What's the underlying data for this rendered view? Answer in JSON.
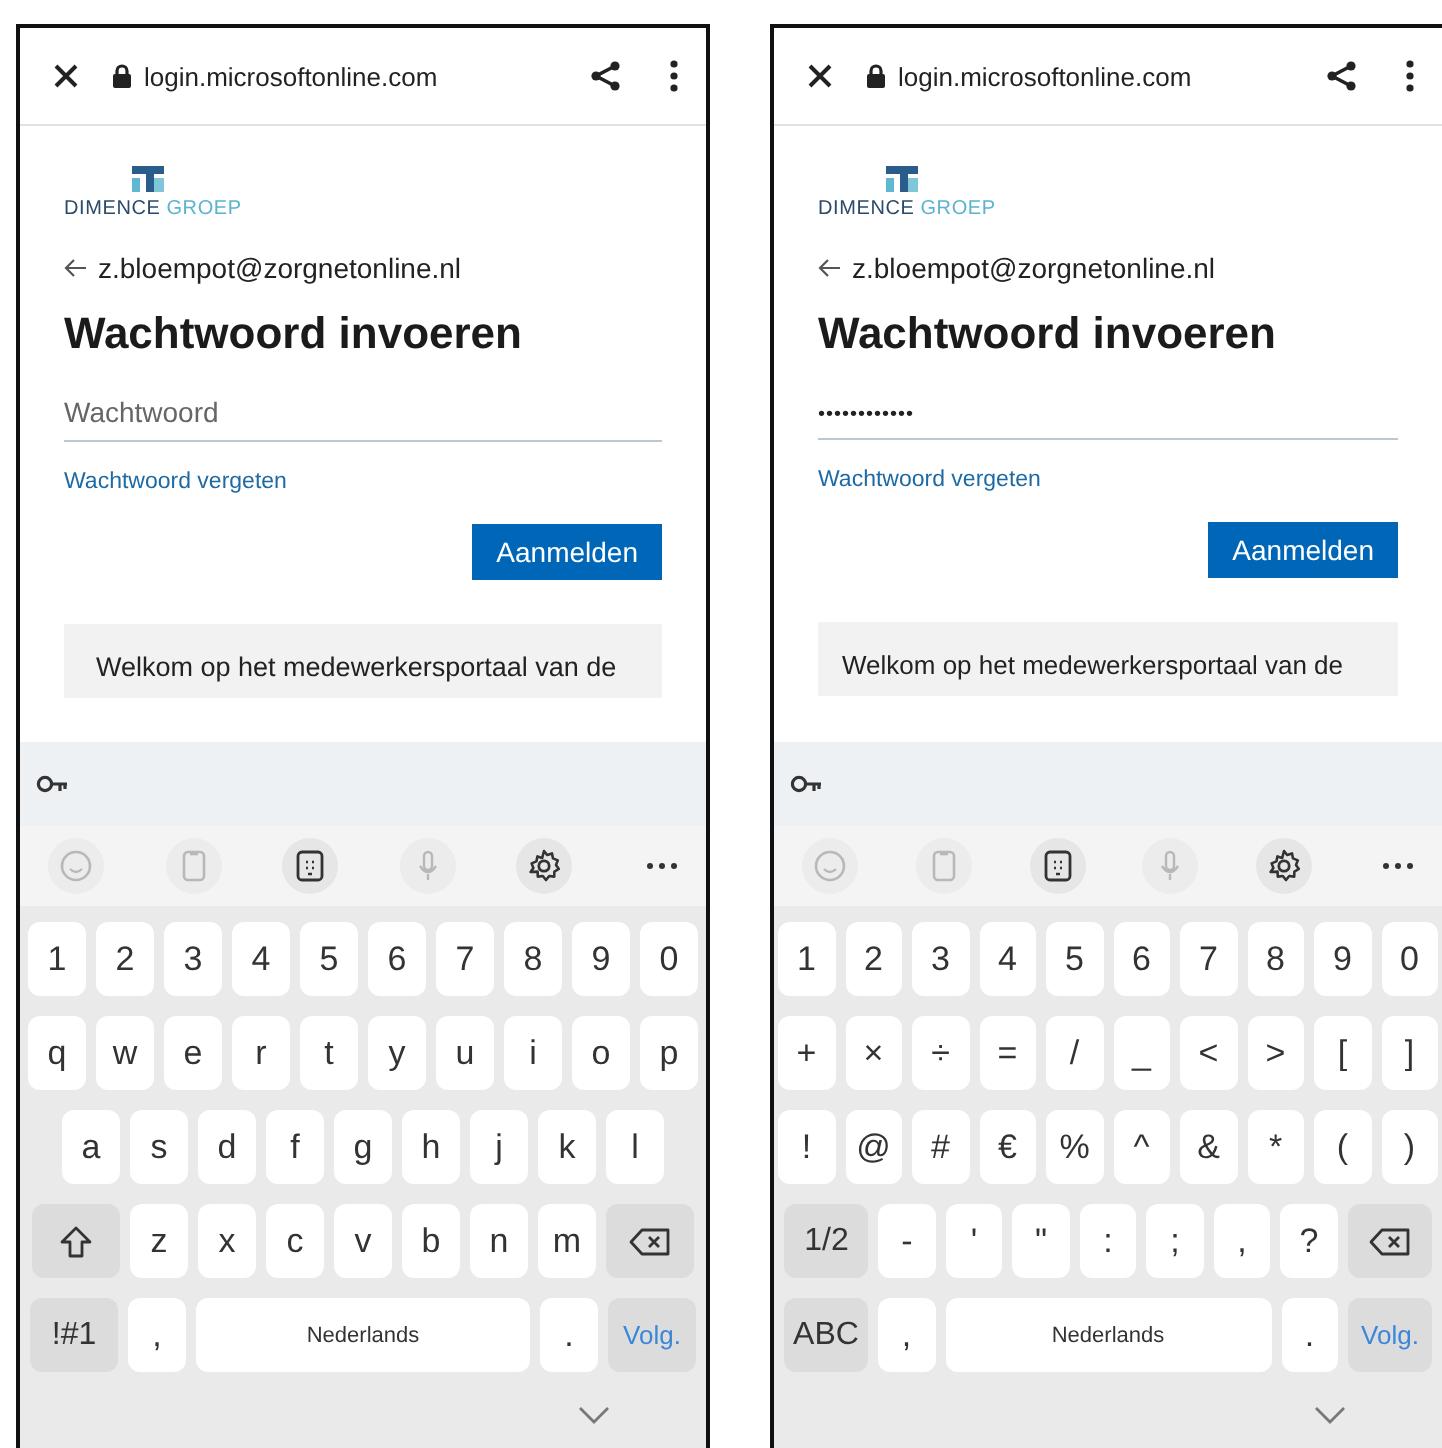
{
  "screens": [
    {
      "browser": {
        "url": "login.microsoftonline.com"
      },
      "page": {
        "logo": {
          "word_1": "DIMENCE",
          "word_2": "GROEP"
        },
        "account": "z.bloempot@zorgnetonline.nl",
        "title": "Wachtwoord invoeren",
        "password_field": {
          "placeholder": "Wachtwoord"
        },
        "forgot_link": "Wachtwoord vergeten",
        "signin_button": "Aanmelden",
        "welcome_text": "Welkom op het medewerkersportaal van de"
      },
      "keyboard": {
        "tools": [
          {
            "kind": "emoji",
            "disabled": true
          },
          {
            "kind": "clipboard",
            "disabled": true
          },
          {
            "kind": "keypad",
            "disabled": false
          },
          {
            "kind": "mic",
            "disabled": true
          },
          {
            "kind": "settings",
            "disabled": false
          },
          {
            "kind": "more",
            "disabled": false
          }
        ],
        "key_rows": [
          {
            "keys": [
              {
                "kind": "char",
                "label": "1"
              },
              {
                "kind": "char",
                "label": "2"
              },
              {
                "kind": "char",
                "label": "3"
              },
              {
                "kind": "char",
                "label": "4"
              },
              {
                "kind": "char",
                "label": "5"
              },
              {
                "kind": "char",
                "label": "6"
              },
              {
                "kind": "char",
                "label": "7"
              },
              {
                "kind": "char",
                "label": "8"
              },
              {
                "kind": "char",
                "label": "9"
              },
              {
                "kind": "char",
                "label": "0"
              }
            ]
          },
          {
            "keys": [
              {
                "kind": "char",
                "label": "q"
              },
              {
                "kind": "char",
                "label": "w"
              },
              {
                "kind": "char",
                "label": "e"
              },
              {
                "kind": "char",
                "label": "r"
              },
              {
                "kind": "char",
                "label": "t"
              },
              {
                "kind": "char",
                "label": "y"
              },
              {
                "kind": "char",
                "label": "u"
              },
              {
                "kind": "char",
                "label": "i"
              },
              {
                "kind": "char",
                "label": "o"
              },
              {
                "kind": "char",
                "label": "p"
              }
            ]
          },
          {
            "keys": [
              {
                "kind": "char",
                "label": "a"
              },
              {
                "kind": "char",
                "label": "s"
              },
              {
                "kind": "char",
                "label": "d"
              },
              {
                "kind": "char",
                "label": "f"
              },
              {
                "kind": "char",
                "label": "g"
              },
              {
                "kind": "char",
                "label": "h"
              },
              {
                "kind": "char",
                "label": "j"
              },
              {
                "kind": "char",
                "label": "k"
              },
              {
                "kind": "char",
                "label": "l"
              }
            ]
          },
          {
            "keys": [
              {
                "kind": "shift"
              },
              {
                "kind": "char",
                "label": "z"
              },
              {
                "kind": "char",
                "label": "x"
              },
              {
                "kind": "char",
                "label": "c"
              },
              {
                "kind": "char",
                "label": "v"
              },
              {
                "kind": "char",
                "label": "b"
              },
              {
                "kind": "char",
                "label": "n"
              },
              {
                "kind": "char",
                "label": "m"
              },
              {
                "kind": "backspace"
              }
            ]
          },
          {
            "keys": [
              {
                "kind": "function",
                "label": "!#1"
              },
              {
                "kind": "char",
                "label": ","
              },
              {
                "kind": "space",
                "label": "Nederlands"
              },
              {
                "kind": "char",
                "label": "."
              },
              {
                "kind": "action",
                "label": "Volg."
              }
            ]
          }
        ]
      }
    },
    {
      "browser": {
        "url": "login.microsoftonline.com"
      },
      "page": {
        "logo": {
          "word_1": "DIMENCE",
          "word_2": "GROEP"
        },
        "account": "z.bloempot@zorgnetonline.nl",
        "title": "Wachtwoord invoeren",
        "password_field": {
          "value": "••••••••••••"
        },
        "forgot_link": "Wachtwoord vergeten",
        "signin_button": "Aanmelden",
        "welcome_text": "Welkom op het medewerkersportaal van de"
      },
      "keyboard": {
        "tools": [
          {
            "kind": "emoji",
            "disabled": true
          },
          {
            "kind": "clipboard",
            "disabled": true
          },
          {
            "kind": "keypad",
            "disabled": false
          },
          {
            "kind": "mic",
            "disabled": true
          },
          {
            "kind": "settings",
            "disabled": false
          },
          {
            "kind": "more",
            "disabled": false
          }
        ],
        "key_rows": [
          {
            "keys": [
              {
                "kind": "char",
                "label": "1"
              },
              {
                "kind": "char",
                "label": "2"
              },
              {
                "kind": "char",
                "label": "3"
              },
              {
                "kind": "char",
                "label": "4"
              },
              {
                "kind": "char",
                "label": "5"
              },
              {
                "kind": "char",
                "label": "6"
              },
              {
                "kind": "char",
                "label": "7"
              },
              {
                "kind": "char",
                "label": "8"
              },
              {
                "kind": "char",
                "label": "9"
              },
              {
                "kind": "char",
                "label": "0"
              }
            ]
          },
          {
            "keys": [
              {
                "kind": "char",
                "label": "+"
              },
              {
                "kind": "char",
                "label": "×"
              },
              {
                "kind": "char",
                "label": "÷"
              },
              {
                "kind": "char",
                "label": "="
              },
              {
                "kind": "char",
                "label": "/"
              },
              {
                "kind": "char",
                "label": "_"
              },
              {
                "kind": "char",
                "label": "<"
              },
              {
                "kind": "char",
                "label": ">"
              },
              {
                "kind": "char",
                "label": "["
              },
              {
                "kind": "char",
                "label": "]"
              }
            ]
          },
          {
            "keys": [
              {
                "kind": "char",
                "label": "!"
              },
              {
                "kind": "char",
                "label": "@"
              },
              {
                "kind": "char",
                "label": "#"
              },
              {
                "kind": "char",
                "label": "€"
              },
              {
                "kind": "char",
                "label": "%"
              },
              {
                "kind": "char",
                "label": "^"
              },
              {
                "kind": "char",
                "label": "&"
              },
              {
                "kind": "char",
                "label": "*"
              },
              {
                "kind": "char",
                "label": "("
              },
              {
                "kind": "char",
                "label": ")"
              }
            ]
          },
          {
            "keys": [
              {
                "kind": "function",
                "label": "1/2"
              },
              {
                "kind": "char",
                "label": "-"
              },
              {
                "kind": "char",
                "label": "'"
              },
              {
                "kind": "char",
                "label": "\""
              },
              {
                "kind": "char",
                "label": ":"
              },
              {
                "kind": "char",
                "label": ";"
              },
              {
                "kind": "char",
                "label": ","
              },
              {
                "kind": "char",
                "label": "?"
              },
              {
                "kind": "backspace"
              }
            ]
          },
          {
            "keys": [
              {
                "kind": "function",
                "label": "ABC"
              },
              {
                "kind": "char",
                "label": ","
              },
              {
                "kind": "space",
                "label": "Nederlands"
              },
              {
                "kind": "char",
                "label": "."
              },
              {
                "kind": "action",
                "label": "Volg."
              }
            ]
          }
        ]
      }
    }
  ]
}
